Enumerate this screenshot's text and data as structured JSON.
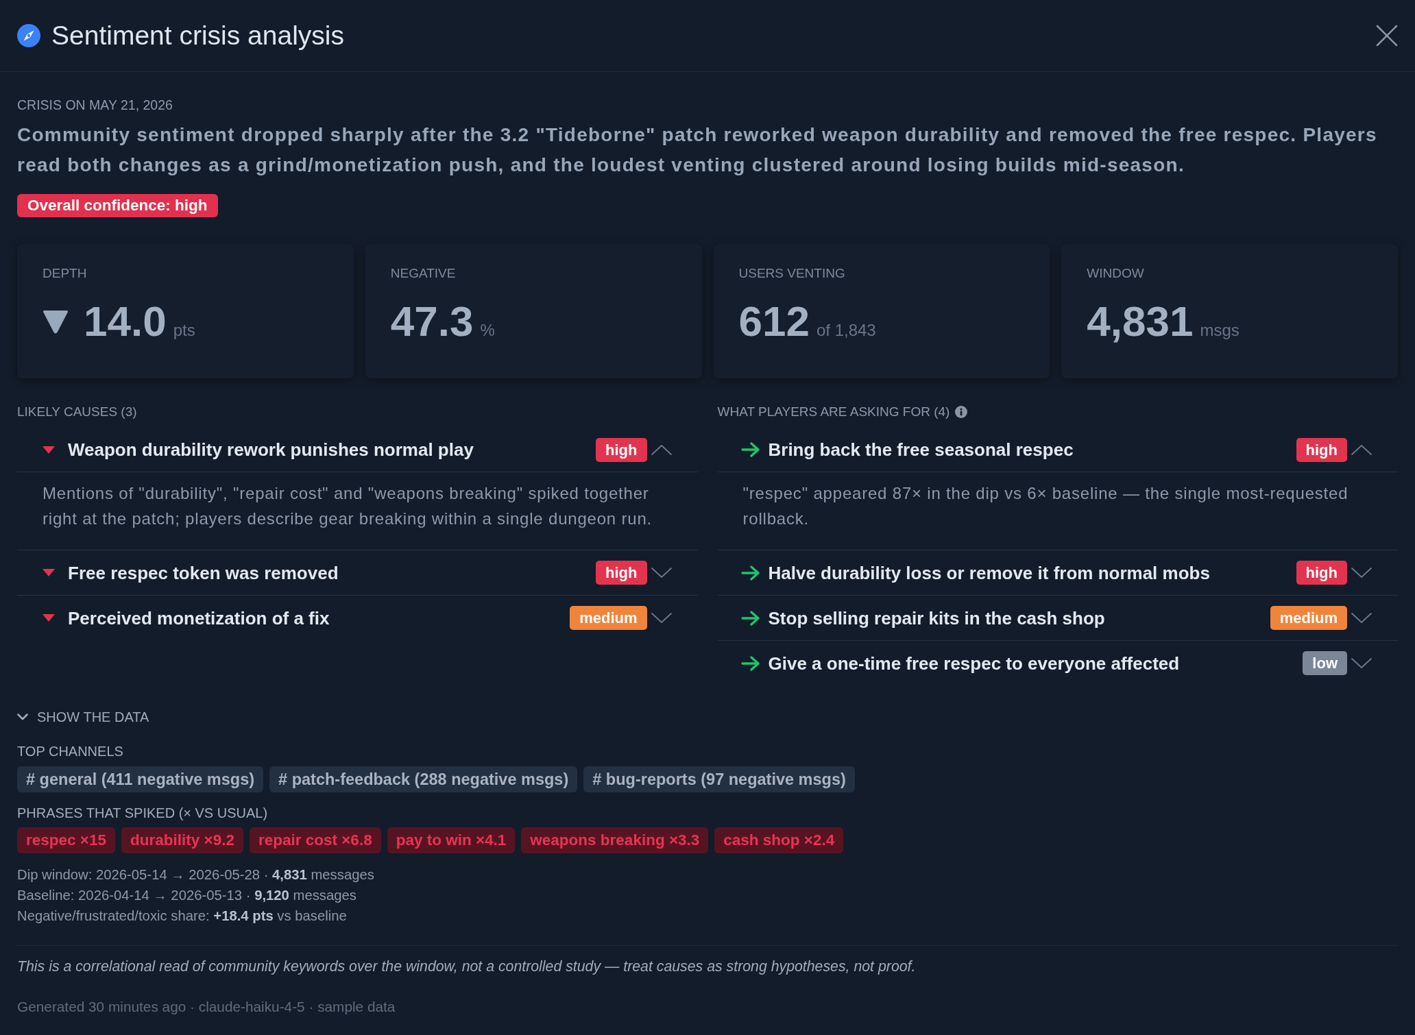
{
  "window": {
    "title": "Sentiment crisis analysis"
  },
  "crisis": {
    "date_label": "CRISIS ON MAY 21, 2026",
    "summary": "Community sentiment dropped sharply after the 3.2 \"Tideborne\" patch reworked weapon durability and removed the free respec. Players read both changes as a grind/monetization push, and the loudest venting clustered around losing builds mid-season.",
    "confidence_badge": "Overall confidence: high"
  },
  "stats": [
    {
      "label": "DEPTH",
      "kind": "drop",
      "value": "14.0",
      "unit": "pts"
    },
    {
      "label": "NEGATIVE",
      "kind": "plain",
      "value": "47.3",
      "unit": "%"
    },
    {
      "label": "USERS VENTING",
      "kind": "plain",
      "value": "612",
      "unit": "of 1,843"
    },
    {
      "label": "WINDOW",
      "kind": "plain",
      "value": "4,831",
      "unit": "msgs"
    }
  ],
  "causes": {
    "heading": "LIKELY CAUSES (3)",
    "items": [
      {
        "title": "Weapon durability rework punishes normal play",
        "badge": {
          "text": "high",
          "color": "#e2344f"
        },
        "expanded": true,
        "detail": "Mentions of \"durability\", \"repair cost\" and \"weapons breaking\" spiked together right at the patch; players describe gear breaking within a single dungeon run."
      },
      {
        "title": "Free respec token was removed",
        "badge": {
          "text": "high",
          "color": "#e2344f"
        },
        "expanded": false
      },
      {
        "title": "Perceived monetization of a fix",
        "badge": {
          "text": "medium",
          "color": "#f0843a"
        },
        "expanded": false
      }
    ]
  },
  "asks": {
    "heading": "WHAT PLAYERS ARE ASKING FOR (4)",
    "items": [
      {
        "title": "Bring back the free seasonal respec",
        "badge": {
          "text": "high",
          "color": "#e2344f"
        },
        "expanded": true,
        "detail": "\"respec\" appeared 87× in the dip vs 6× baseline — the single most-requested rollback."
      },
      {
        "title": "Halve durability loss or remove it from normal mobs",
        "badge": {
          "text": "high",
          "color": "#e2344f"
        },
        "expanded": false
      },
      {
        "title": "Stop selling repair kits in the cash shop",
        "badge": {
          "text": "medium",
          "color": "#f0843a"
        },
        "expanded": false
      },
      {
        "title": "Give a one-time free respec to everyone affected",
        "badge": {
          "text": "low",
          "color": "#7b8797"
        },
        "expanded": false
      }
    ]
  },
  "data_section": {
    "toggle": "SHOW THE DATA",
    "expanded": true,
    "channels_heading": "TOP CHANNELS",
    "channels": [
      "# general (411 negative msgs)",
      "# patch-feedback (288 negative msgs)",
      "# bug-reports (97 negative msgs)"
    ],
    "phrases_heading": "PHRASES THAT SPIKED (× VS USUAL)",
    "phrases": [
      "respec ×15",
      "durability ×9.2",
      "repair cost ×6.8",
      "pay to win ×4.1",
      "weapons breaking ×3.3",
      "cash shop ×2.4"
    ],
    "stat_lines": [
      "Dip window: 2026-05-14 → 2026-05-28 · **4,831** messages",
      "Baseline: 2026-04-14 → 2026-05-13 · **9,120** messages",
      "Negative/frustrated/toxic share: **+18.4 pts** vs baseline"
    ]
  },
  "disclaimer": "This is a correlational read of community keywords over the window, not a controlled study — treat causes as strong hypotheses, not proof.",
  "footer": "Generated 30 minutes ago · claude-haiku-4-5 · sample data"
}
